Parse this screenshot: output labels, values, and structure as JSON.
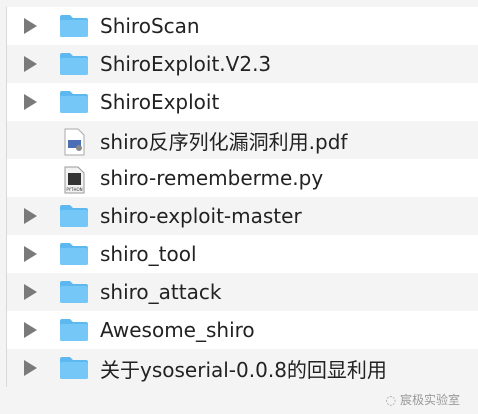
{
  "items": [
    {
      "name": "ShiroScan",
      "type": "folder"
    },
    {
      "name": "ShiroExploit.V2.3",
      "type": "folder"
    },
    {
      "name": "ShiroExploit",
      "type": "folder"
    },
    {
      "name": "shiro反序列化漏洞利用.pdf",
      "type": "pdf"
    },
    {
      "name": "shiro-rememberme.py",
      "type": "python"
    },
    {
      "name": "shiro-exploit-master",
      "type": "folder"
    },
    {
      "name": "shiro_tool",
      "type": "folder"
    },
    {
      "name": "shiro_attack",
      "type": "folder"
    },
    {
      "name": "Awesome_shiro",
      "type": "folder"
    },
    {
      "name": "关于ysoserial-0.0.8的回显利用",
      "type": "folder"
    }
  ],
  "python_badge": "PYTHON",
  "watermark": "宸极实验室",
  "colors": {
    "folder": "#6cc3f5",
    "triangle": "#7a7a7a"
  }
}
